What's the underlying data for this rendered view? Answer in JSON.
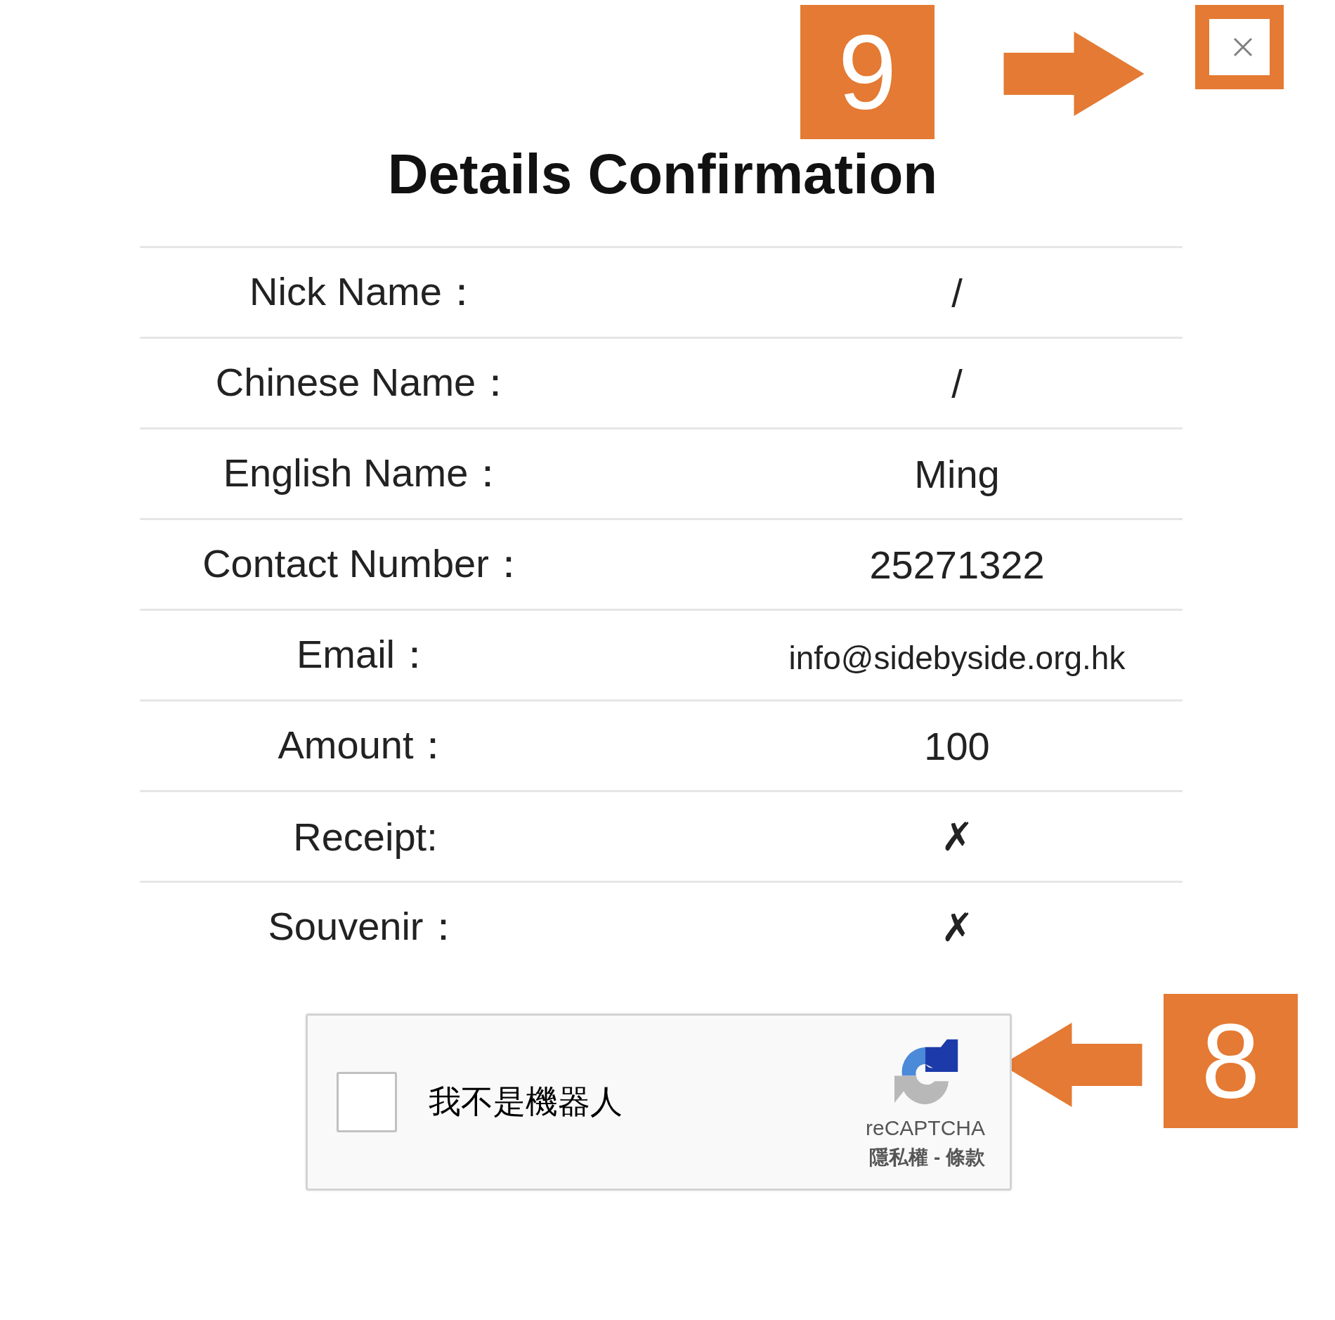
{
  "dialog": {
    "title": "Details Confirmation",
    "rows": [
      {
        "label": "Nick Name：",
        "value": "/"
      },
      {
        "label": "Chinese Name：",
        "value": "/"
      },
      {
        "label": "English Name：",
        "value": "Ming"
      },
      {
        "label": "Contact Number：",
        "value": "25271322"
      },
      {
        "label": "Email：",
        "value": "info@sidebyside.org.hk",
        "kind": "small"
      },
      {
        "label": "Amount：",
        "value": "100"
      },
      {
        "label": "Receipt:",
        "value": "✗"
      },
      {
        "label": "Souvenir：",
        "value": "✗"
      }
    ],
    "recaptcha": {
      "checked": false,
      "label": "我不是機器人",
      "brand": "reCAPTCHA",
      "links": "隱私權 - 條款"
    }
  },
  "annotations": [
    {
      "label": "9",
      "kind": "right"
    },
    {
      "label": "8",
      "kind": "left"
    }
  ]
}
